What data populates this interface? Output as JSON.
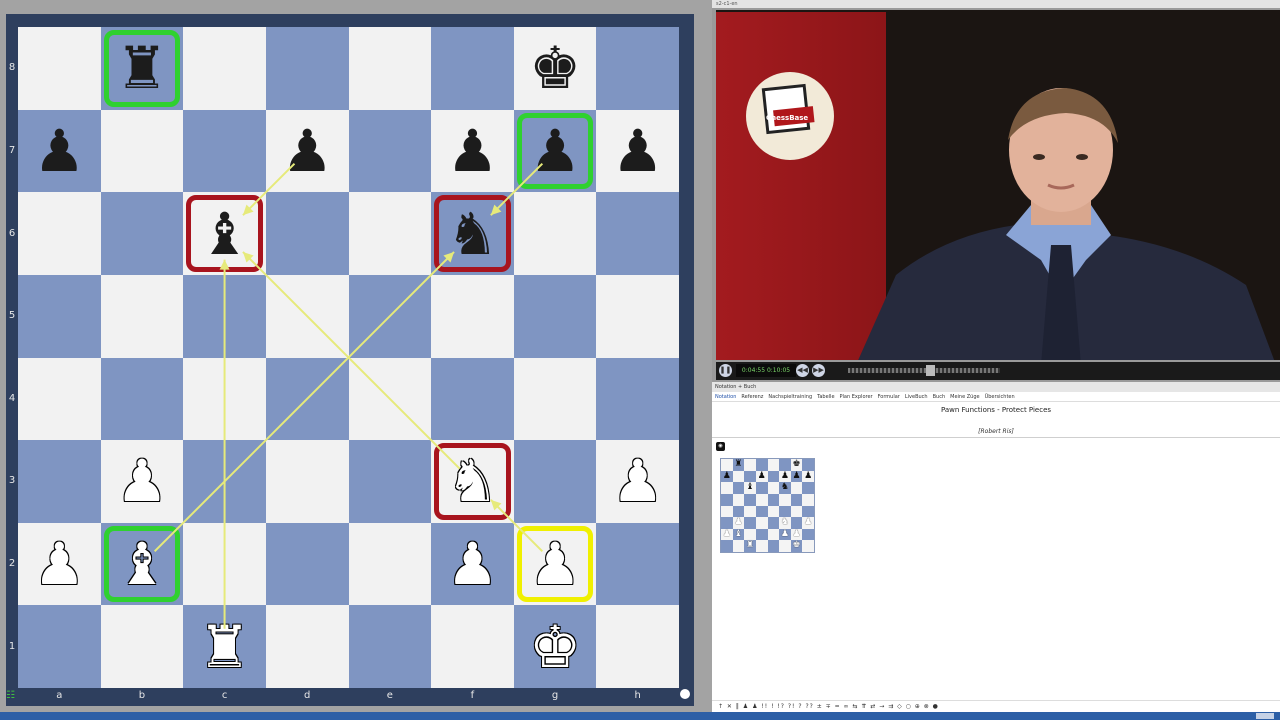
{
  "board": {
    "ranks": [
      "8",
      "7",
      "6",
      "5",
      "4",
      "3",
      "2",
      "1"
    ],
    "files": [
      "a",
      "b",
      "c",
      "d",
      "e",
      "f",
      "g",
      "h"
    ],
    "pieces": [
      {
        "sq": "b8",
        "glyph": "♜",
        "color": "black",
        "name": "rook"
      },
      {
        "sq": "g8",
        "glyph": "♚",
        "color": "black",
        "name": "king"
      },
      {
        "sq": "a7",
        "glyph": "♟",
        "color": "black",
        "name": "pawn"
      },
      {
        "sq": "d7",
        "glyph": "♟",
        "color": "black",
        "name": "pawn"
      },
      {
        "sq": "f7",
        "glyph": "♟",
        "color": "black",
        "name": "pawn"
      },
      {
        "sq": "g7",
        "glyph": "♟",
        "color": "black",
        "name": "pawn"
      },
      {
        "sq": "h7",
        "glyph": "♟",
        "color": "black",
        "name": "pawn"
      },
      {
        "sq": "c6",
        "glyph": "♝",
        "color": "black",
        "name": "bishop"
      },
      {
        "sq": "f6",
        "glyph": "♞",
        "color": "black",
        "name": "knight"
      },
      {
        "sq": "b3",
        "glyph": "♟",
        "color": "white",
        "name": "pawn"
      },
      {
        "sq": "f3",
        "glyph": "♞",
        "color": "white",
        "name": "knight"
      },
      {
        "sq": "h3",
        "glyph": "♟",
        "color": "white",
        "name": "pawn"
      },
      {
        "sq": "a2",
        "glyph": "♟",
        "color": "white",
        "name": "pawn"
      },
      {
        "sq": "b2",
        "glyph": "♝",
        "color": "white",
        "name": "bishop"
      },
      {
        "sq": "f2",
        "glyph": "♟",
        "color": "white",
        "name": "pawn"
      },
      {
        "sq": "g2",
        "glyph": "♟",
        "color": "white",
        "name": "pawn"
      },
      {
        "sq": "c1",
        "glyph": "♜",
        "color": "white",
        "name": "rook"
      },
      {
        "sq": "g1",
        "glyph": "♚",
        "color": "white",
        "name": "king"
      }
    ],
    "highlights": [
      {
        "sq": "b8",
        "color": "#2fd12f"
      },
      {
        "sq": "g7",
        "color": "#2fd12f"
      },
      {
        "sq": "c6",
        "color": "#a8141e"
      },
      {
        "sq": "f6",
        "color": "#a8141e"
      },
      {
        "sq": "f3",
        "color": "#a8141e"
      },
      {
        "sq": "b2",
        "color": "#2fd12f"
      },
      {
        "sq": "g2",
        "color": "#f0f000"
      }
    ],
    "arrows": [
      {
        "from": "d7",
        "to": "c6"
      },
      {
        "from": "g7",
        "to": "f6"
      },
      {
        "from": "c1",
        "to": "c6"
      },
      {
        "from": "b2",
        "to": "f6"
      },
      {
        "from": "f3",
        "to": "c6"
      },
      {
        "from": "g2",
        "to": "f3"
      }
    ],
    "arrow_color": "#e6ea7a"
  },
  "video": {
    "window_title": "s2-c1-en",
    "logo_text": "ChessBase",
    "time": "0:04:55 0:10:05"
  },
  "notation": {
    "panel_title": "Notation + Buch",
    "tabs": [
      "Notation",
      "Referenz",
      "Nachspieltraining",
      "Tabelle",
      "Plan Explorer",
      "Formular",
      "LiveBuch",
      "Buch",
      "Meine Züge",
      "Übersichten"
    ],
    "game_title": "Pawn Functions - Protect Pieces",
    "author": "[Robert Ris]",
    "toolbar": "↑ ✕ ‖ ♟ ♟ !! ! !? ?! ? ?? ± ∓ = ∞ ⇆ ⇈ ⇄ → ⇉ ◇ ○ ⊕ ⊗ ●"
  }
}
